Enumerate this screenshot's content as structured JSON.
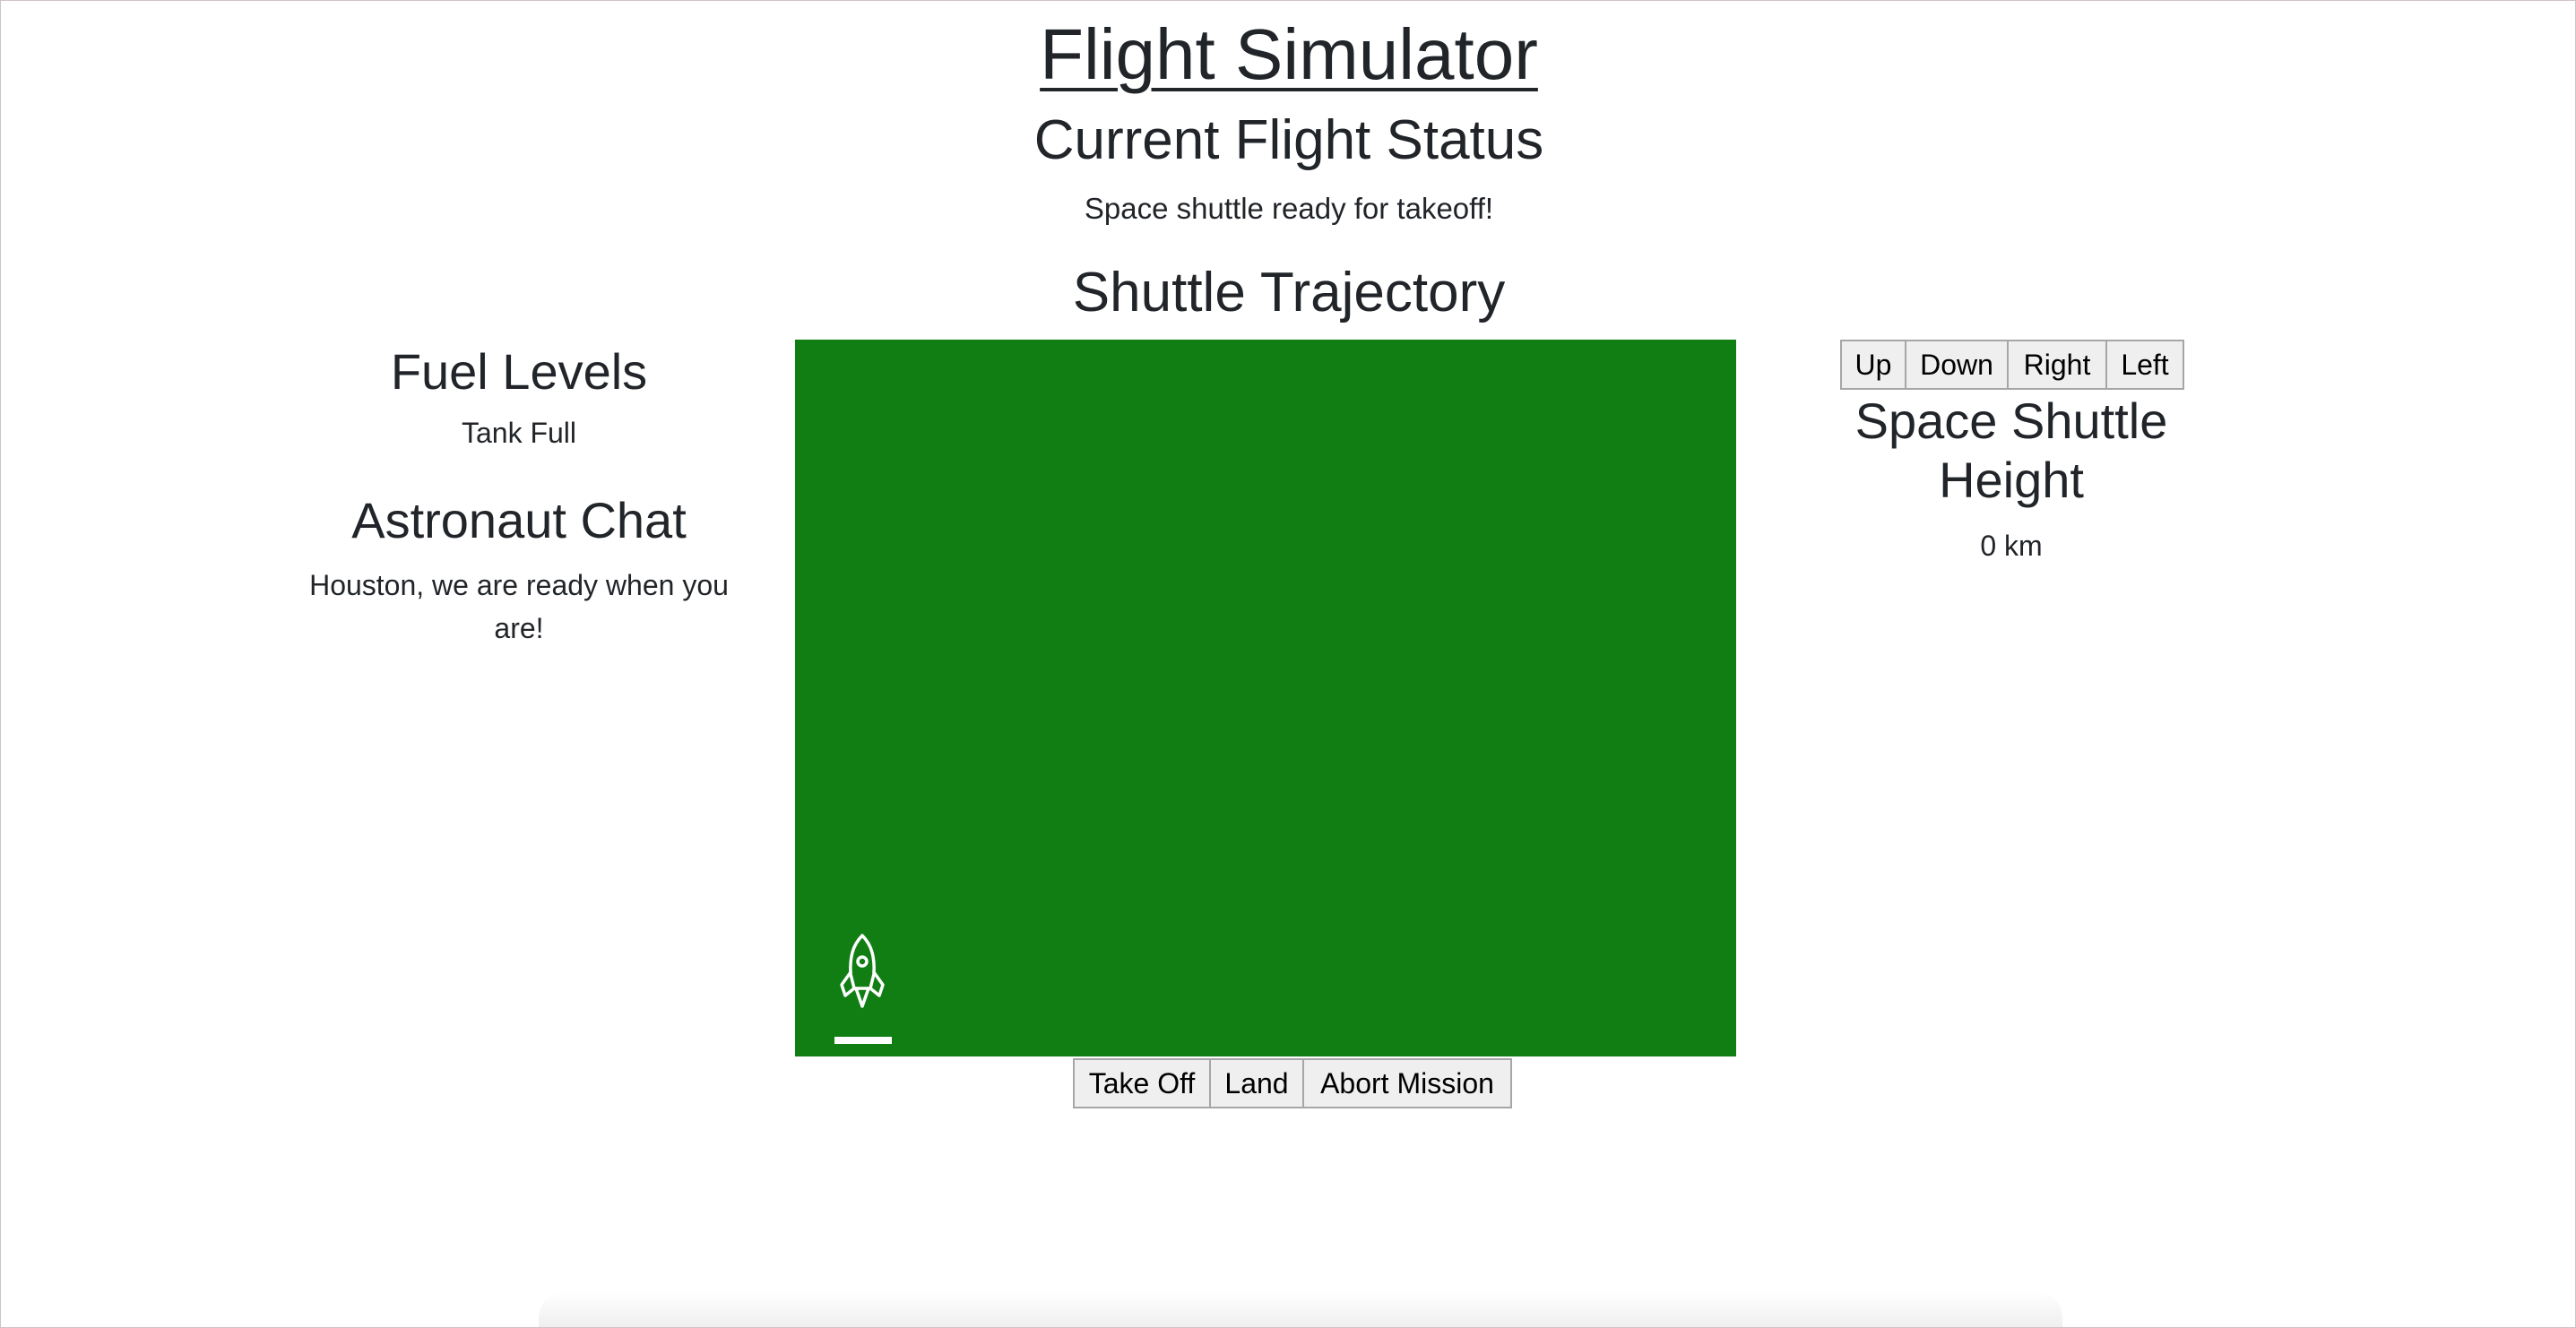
{
  "header": {
    "title": "Flight Simulator",
    "status_heading": "Current Flight Status",
    "status_text": "Space shuttle ready for takeoff!",
    "trajectory_heading": "Shuttle Trajectory"
  },
  "left_panel": {
    "fuel_heading": "Fuel Levels",
    "fuel_text": "Tank Full",
    "chat_heading": "Astronaut Chat",
    "chat_text": "Houston, we are ready when you are!"
  },
  "right_panel": {
    "direction_buttons": [
      "Up",
      "Down",
      "Right",
      "Left"
    ],
    "height_heading": "Space Shuttle Height",
    "height_value": "0 km"
  },
  "controls": {
    "takeoff_label": "Take Off",
    "land_label": "Land",
    "abort_label": "Abort Mission"
  },
  "trajectory": {
    "background_color": "#117e14",
    "icon": "rocket-icon"
  }
}
